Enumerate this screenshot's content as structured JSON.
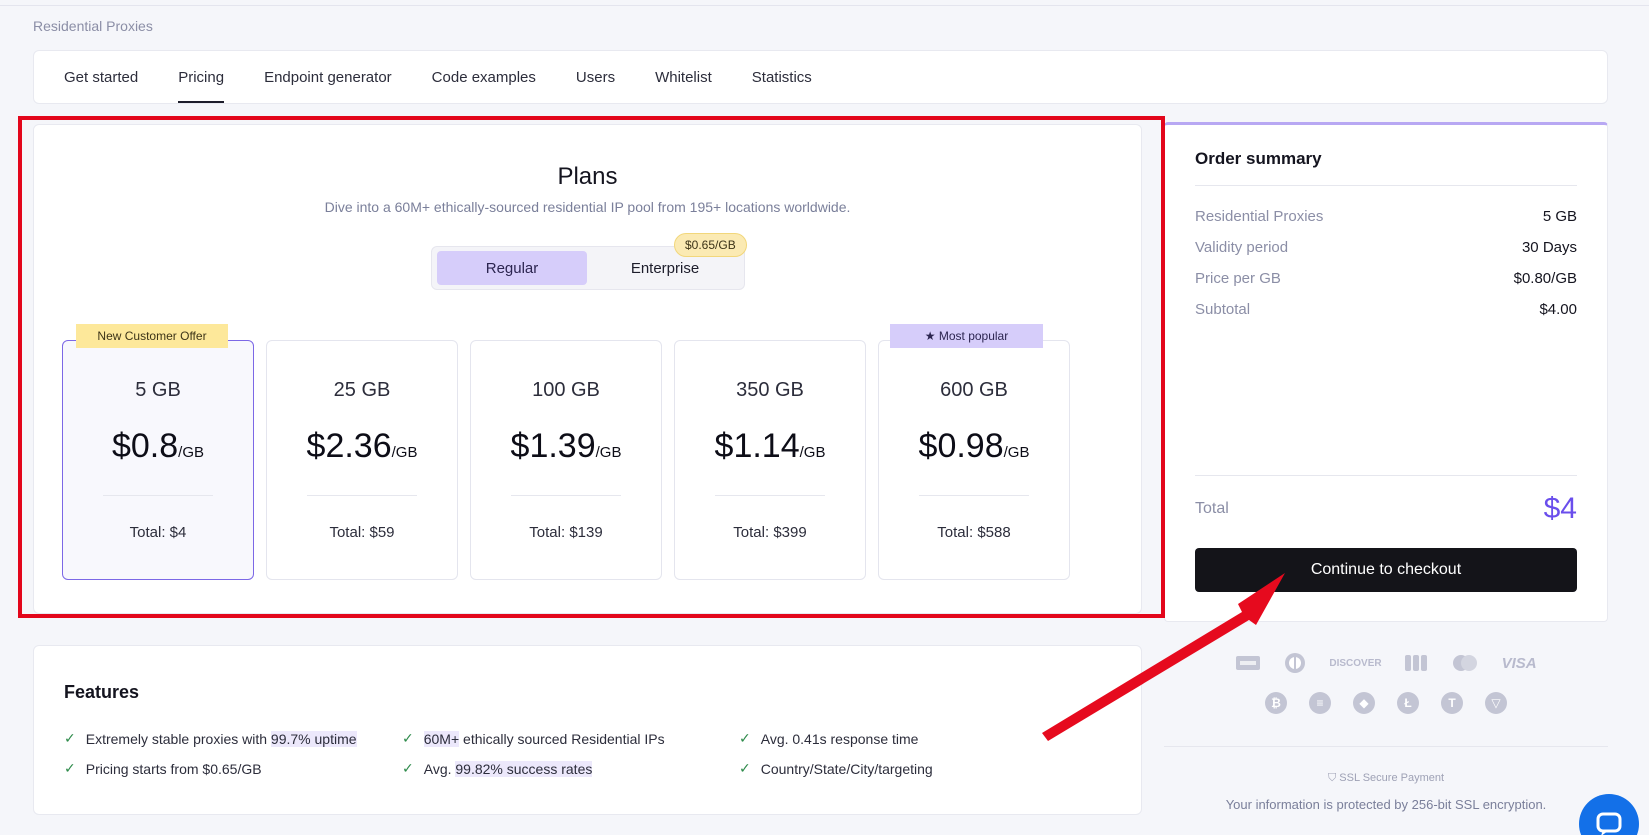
{
  "breadcrumb": "Residential Proxies",
  "tabs": [
    {
      "label": "Get started"
    },
    {
      "label": "Pricing",
      "active": true
    },
    {
      "label": "Endpoint generator"
    },
    {
      "label": "Code examples"
    },
    {
      "label": "Users"
    },
    {
      "label": "Whitelist"
    },
    {
      "label": "Statistics"
    }
  ],
  "plans": {
    "title": "Plans",
    "subtitle": "Dive into a 60M+ ethically-sourced residential IP pool from 195+ locations worldwide.",
    "toggle": {
      "regular": "Regular",
      "enterprise": "Enterprise",
      "enterprise_badge": "$0.65/GB",
      "selected": "Regular"
    },
    "cards": [
      {
        "gb": "5 GB",
        "price": "$0.8",
        "unit": "/GB",
        "total": "Total: $4",
        "ribbon": "New Customer Offer",
        "selected": true
      },
      {
        "gb": "25 GB",
        "price": "$2.36",
        "unit": "/GB",
        "total": "Total: $59"
      },
      {
        "gb": "100 GB",
        "price": "$1.39",
        "unit": "/GB",
        "total": "Total: $139"
      },
      {
        "gb": "350 GB",
        "price": "$1.14",
        "unit": "/GB",
        "total": "Total: $399"
      },
      {
        "gb": "600 GB",
        "price": "$0.98",
        "unit": "/GB",
        "total": "Total: $588",
        "ribbon": "★ Most popular"
      }
    ]
  },
  "summary": {
    "title": "Order summary",
    "rows": [
      {
        "label": "Residential Proxies",
        "value": "5 GB"
      },
      {
        "label": "Validity period",
        "value": "30 Days"
      },
      {
        "label": "Price per GB",
        "value": "$0.80/GB"
      },
      {
        "label": "Subtotal",
        "value": "$4.00"
      }
    ],
    "total_label": "Total",
    "total_value": "$4",
    "checkout_label": "Continue to checkout"
  },
  "payments": {
    "cards": [
      "amex-icon",
      "diners-icon",
      "discover-icon",
      "jcb-icon",
      "mastercard-icon",
      "visa-icon"
    ],
    "visa_label": "VISA",
    "discover_label": "DISCOVER",
    "coins": [
      "bitcoin-icon",
      "dash-icon",
      "ethereum-icon",
      "litecoin-icon",
      "tether-icon",
      "tron-icon"
    ],
    "ssl_label": "SSL Secure Payment",
    "ssl_note": "Your information is protected by 256-bit SSL encryption."
  },
  "features": {
    "title": "Features",
    "items": [
      {
        "pre": "Extremely stable proxies with ",
        "hl": "99.7% uptime",
        "post": ""
      },
      {
        "pre": "",
        "hl": "60M+",
        "post": " ethically sourced Residential IPs"
      },
      {
        "pre": "Avg. 0.41s response time",
        "hl": "",
        "post": ""
      },
      {
        "pre": "Pricing starts from $0.65/GB",
        "hl": "",
        "post": ""
      },
      {
        "pre": "Avg. ",
        "hl": "99.82% success rates",
        "post": ""
      },
      {
        "pre": "Country/State/City/targeting",
        "hl": "",
        "post": ""
      }
    ]
  },
  "colors": {
    "accent": "#6a4eec",
    "annotation": "#e3061b",
    "selected_toggle": "#d6cdfa",
    "offer_ribbon": "#fde89a"
  }
}
